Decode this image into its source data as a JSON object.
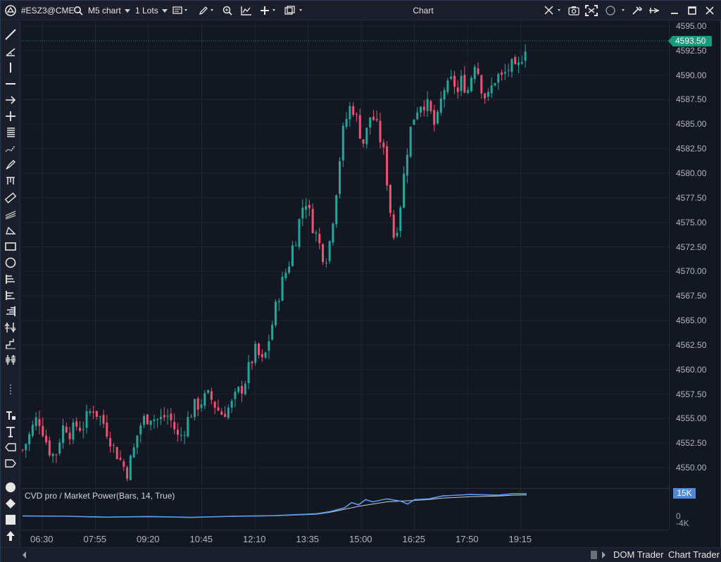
{
  "toolbar": {
    "symbol": "#ESZ3@CME",
    "timeframe": "M5 chart",
    "lots": "1 Lots",
    "window_title": "Chart"
  },
  "price_axis": {
    "labels": [
      "4595.00",
      "4592.50",
      "4590.00",
      "4587.50",
      "4585.00",
      "4582.50",
      "4580.00",
      "4577.50",
      "4575.00",
      "4572.50",
      "4570.00",
      "4567.50",
      "4565.00",
      "4562.50",
      "4560.00",
      "4557.50",
      "4555.00",
      "4552.50",
      "4550.00"
    ],
    "last_price": "4593.50"
  },
  "indicator": {
    "title": "CVD pro / Market Power(Bars, 14, True)",
    "axis_labels": [
      "15K",
      "0",
      "-4K"
    ],
    "value_tag": "15K"
  },
  "time_axis": {
    "labels": [
      "06:30",
      "07:55",
      "09:20",
      "10:45",
      "12:10",
      "13:35",
      "15:00",
      "16:25",
      "17:50",
      "19:15"
    ]
  },
  "bottom": {
    "dom_trader": "DOM Trader",
    "chart_trader": "Chart Trader"
  },
  "colors": {
    "background": "#131722",
    "up": "#26a69a",
    "down": "#ef5372",
    "last_price": "#159b7a",
    "cvd_line": "#5b9cf0",
    "cvd_signal": "#c8ccd4"
  },
  "chart_data": {
    "type": "candlestick",
    "instrument": "#ESZ3@CME",
    "timeframe": "M5",
    "ylim": [
      4548.0,
      4595.5
    ],
    "last_price": 4593.5,
    "close_path": [
      [
        0,
        4551.8
      ],
      [
        4,
        4552.5
      ],
      [
        8,
        4553.2
      ],
      [
        12,
        4554.0
      ],
      [
        16,
        4554.8
      ],
      [
        20,
        4555.0
      ],
      [
        24,
        4554.2
      ],
      [
        28,
        4553.0
      ],
      [
        32,
        4552.0
      ],
      [
        36,
        4551.5
      ],
      [
        40,
        4551.0
      ],
      [
        44,
        4552.5
      ],
      [
        48,
        4553.8
      ],
      [
        52,
        4554.5
      ],
      [
        56,
        4554.0
      ],
      [
        60,
        4553.5
      ],
      [
        64,
        4554.0
      ],
      [
        68,
        4554.5
      ],
      [
        72,
        4554.0
      ],
      [
        76,
        4554.5
      ],
      [
        80,
        4555.2
      ],
      [
        84,
        4555.8
      ],
      [
        88,
        4556.2
      ],
      [
        92,
        4555.5
      ],
      [
        96,
        4555.0
      ],
      [
        100,
        4554.5
      ],
      [
        104,
        4553.8
      ],
      [
        108,
        4553.0
      ],
      [
        112,
        4552.0
      ],
      [
        116,
        4551.5
      ],
      [
        120,
        4550.8
      ],
      [
        124,
        4550.2
      ],
      [
        128,
        4549.5
      ],
      [
        132,
        4550.5
      ],
      [
        136,
        4551.5
      ],
      [
        140,
        4553.0
      ],
      [
        144,
        4554.2
      ],
      [
        148,
        4554.8
      ],
      [
        152,
        4555.0
      ],
      [
        156,
        4555.5
      ],
      [
        160,
        4555.2
      ],
      [
        164,
        4554.8
      ],
      [
        168,
        4555.0
      ],
      [
        172,
        4554.8
      ],
      [
        176,
        4555.5
      ],
      [
        180,
        4555.2
      ],
      [
        184,
        4554.5
      ],
      [
        188,
        4553.8
      ],
      [
        192,
        4552.8
      ],
      [
        196,
        4553.5
      ],
      [
        200,
        4554.3
      ],
      [
        204,
        4555.0
      ],
      [
        208,
        4555.8
      ],
      [
        212,
        4556.2
      ],
      [
        216,
        4556.5
      ],
      [
        220,
        4556.8
      ],
      [
        224,
        4557.0
      ],
      [
        228,
        4557.2
      ],
      [
        232,
        4557.0
      ],
      [
        236,
        4556.5
      ],
      [
        240,
        4556.0
      ],
      [
        244,
        4555.5
      ],
      [
        248,
        4555.8
      ],
      [
        252,
        4556.0
      ],
      [
        256,
        4556.2
      ],
      [
        260,
        4556.8
      ],
      [
        264,
        4557.5
      ],
      [
        268,
        4558.0
      ],
      [
        272,
        4558.5
      ],
      [
        276,
        4559.5
      ],
      [
        280,
        4560.5
      ],
      [
        284,
        4561.5
      ],
      [
        288,
        4562.0
      ],
      [
        292,
        4561.0
      ],
      [
        296,
        4560.5
      ],
      [
        300,
        4562.0
      ],
      [
        304,
        4563.5
      ],
      [
        308,
        4565.0
      ],
      [
        312,
        4566.5
      ],
      [
        316,
        4568.0
      ],
      [
        320,
        4569.0
      ],
      [
        324,
        4570.0
      ],
      [
        328,
        4571.0
      ],
      [
        332,
        4572.5
      ],
      [
        336,
        4573.5
      ],
      [
        340,
        4575.0
      ],
      [
        344,
        4576.5
      ],
      [
        348,
        4577.5
      ],
      [
        352,
        4576.0
      ],
      [
        356,
        4575.0
      ],
      [
        360,
        4574.0
      ],
      [
        364,
        4573.0
      ],
      [
        368,
        4572.0
      ],
      [
        372,
        4571.5
      ],
      [
        376,
        4572.0
      ],
      [
        380,
        4574.5
      ],
      [
        384,
        4577.0
      ],
      [
        388,
        4580.0
      ],
      [
        392,
        4583.0
      ],
      [
        396,
        4585.0
      ],
      [
        400,
        4586.0
      ],
      [
        404,
        4587.0
      ],
      [
        408,
        4586.5
      ],
      [
        412,
        4585.0
      ],
      [
        416,
        4584.0
      ],
      [
        420,
        4583.0
      ],
      [
        424,
        4584.5
      ],
      [
        428,
        4586.0
      ],
      [
        432,
        4585.5
      ],
      [
        436,
        4584.5
      ],
      [
        440,
        4583.5
      ],
      [
        444,
        4582.0
      ],
      [
        448,
        4579.5
      ],
      [
        452,
        4576.5
      ],
      [
        456,
        4573.5
      ],
      [
        460,
        4574.5
      ],
      [
        464,
        4576.5
      ],
      [
        468,
        4579.0
      ],
      [
        472,
        4582.0
      ],
      [
        476,
        4584.0
      ],
      [
        480,
        4585.5
      ],
      [
        484,
        4586.5
      ],
      [
        488,
        4587.0
      ],
      [
        492,
        4587.5
      ],
      [
        496,
        4587.0
      ],
      [
        500,
        4586.5
      ],
      [
        504,
        4585.5
      ],
      [
        508,
        4584.5
      ],
      [
        512,
        4586.0
      ],
      [
        516,
        4588.0
      ],
      [
        520,
        4589.0
      ],
      [
        524,
        4588.5
      ],
      [
        528,
        4589.5
      ],
      [
        532,
        4589.0
      ],
      [
        536,
        4588.0
      ],
      [
        540,
        4589.5
      ],
      [
        544,
        4589.0
      ],
      [
        548,
        4588.5
      ],
      [
        552,
        4590.0
      ],
      [
        556,
        4591.5
      ],
      [
        560,
        4590.5
      ],
      [
        564,
        4589.0
      ],
      [
        568,
        4588.0
      ],
      [
        572,
        4587.5
      ],
      [
        576,
        4588.5
      ],
      [
        580,
        4589.5
      ],
      [
        584,
        4590.0
      ],
      [
        588,
        4589.5
      ],
      [
        592,
        4590.0
      ],
      [
        596,
        4590.5
      ],
      [
        600,
        4591.0
      ],
      [
        604,
        4590.5
      ],
      [
        608,
        4590.0
      ],
      [
        612,
        4591.5
      ],
      [
        616,
        4592.5
      ],
      [
        620,
        4593.5
      ]
    ],
    "cvd": {
      "ylim": [
        -4000,
        15000
      ],
      "line": [
        [
          0,
          0
        ],
        [
          60,
          -200
        ],
        [
          120,
          -800
        ],
        [
          180,
          -400
        ],
        [
          240,
          -1000
        ],
        [
          300,
          -200
        ],
        [
          360,
          200
        ],
        [
          420,
          1500
        ],
        [
          440,
          3000
        ],
        [
          460,
          5500
        ],
        [
          470,
          9000
        ],
        [
          480,
          7500
        ],
        [
          490,
          11000
        ],
        [
          500,
          9500
        ],
        [
          520,
          11500
        ],
        [
          540,
          10000
        ],
        [
          550,
          8000
        ],
        [
          560,
          11000
        ],
        [
          580,
          11500
        ],
        [
          600,
          13500
        ],
        [
          640,
          14500
        ],
        [
          680,
          14000
        ],
        [
          700,
          15000
        ],
        [
          720,
          15000
        ]
      ],
      "signal": [
        [
          0,
          0
        ],
        [
          60,
          -200
        ],
        [
          120,
          -700
        ],
        [
          180,
          -500
        ],
        [
          240,
          -900
        ],
        [
          300,
          -300
        ],
        [
          360,
          100
        ],
        [
          420,
          1200
        ],
        [
          440,
          2500
        ],
        [
          460,
          4500
        ],
        [
          480,
          6500
        ],
        [
          500,
          8000
        ],
        [
          520,
          9500
        ],
        [
          540,
          10000
        ],
        [
          560,
          10500
        ],
        [
          580,
          11000
        ],
        [
          600,
          12000
        ],
        [
          640,
          13000
        ],
        [
          680,
          13500
        ],
        [
          700,
          14000
        ],
        [
          720,
          14200
        ]
      ]
    }
  }
}
